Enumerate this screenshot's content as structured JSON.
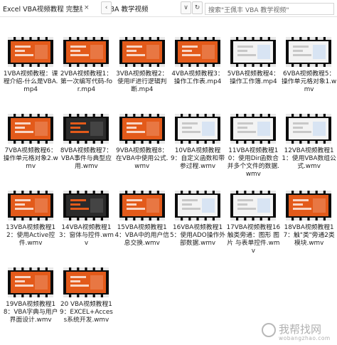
{
  "titlebar": {
    "tab_title": "Excel VBA视频教程 完整版",
    "tab_rest": "VBA  教学视频",
    "close_glyph": "×",
    "prev_glyph": "‹",
    "dropdown_glyph": "∨",
    "refresh_glyph": "↻"
  },
  "search": {
    "placeholder": "搜索\"王佩丰 VBA  教学视频\""
  },
  "files": [
    {
      "label": "1VBA视频教程：课程介绍-什么是VBA.mp4",
      "thumb": "orange"
    },
    {
      "label": "2VBA视频教程1：第一次编写代码-for.mp4",
      "thumb": "orange"
    },
    {
      "label": "3VBA视频教程2：使用IF进行逻辑判断.mp4",
      "thumb": "orange"
    },
    {
      "label": "4VBA视频教程3：操作工作表.mp4",
      "thumb": "orange"
    },
    {
      "label": "5VBA视频教程4：操作工作簿.mp4",
      "thumb": "white"
    },
    {
      "label": "6VBA视频教程5：操作单元格对象1.wmv",
      "thumb": "white"
    },
    {
      "label": "7VBA视频教程6：操作单元格对象2.wmv",
      "thumb": "orange"
    },
    {
      "label": "8VBA视频教程7：VBA事件与典型应用.wmv",
      "thumb": "dark"
    },
    {
      "label": "9VBA视频教程8：在VBA中使用公式.wmv",
      "thumb": "orange"
    },
    {
      "label": "10VBA视频教程9：自定义函数和带参过程.wmv",
      "thumb": "white"
    },
    {
      "label": "11VBA视频教程10：使用Dir函数合并多个文件的数据.wmv",
      "thumb": "white"
    },
    {
      "label": "12VBA视频教程11：使用VBA数组公式.wmv",
      "thumb": "white"
    },
    {
      "label": "13VBA视频教程12：使用Active控件.wmv",
      "thumb": "orange"
    },
    {
      "label": "14VBA视频教程13：窗体与控件.wmv",
      "thumb": "dark"
    },
    {
      "label": "15VBA视频教程14：VBA中的用户信息交换.wmv",
      "thumb": "orange"
    },
    {
      "label": "16VBA视频教程15：使用ADO操作外部数据.wmv",
      "thumb": "white"
    },
    {
      "label": "17VBA视频教程16 触类旁通：图形 图片 与表单控件.wmv",
      "thumb": "white"
    },
    {
      "label": "18VBA视频教程17：触\"类\"旁通2类模块.wmv",
      "thumb": "orange"
    },
    {
      "label": "19VBA视频教程18：VBA字典与用户界面设计.wmv",
      "thumb": "orange"
    },
    {
      "label": "20 VBA视频教程19：EXCEL+Access系统开发.wmv",
      "thumb": "orange"
    }
  ],
  "watermark": {
    "cn": "我帮找网",
    "url": "wobangzhao.com"
  }
}
